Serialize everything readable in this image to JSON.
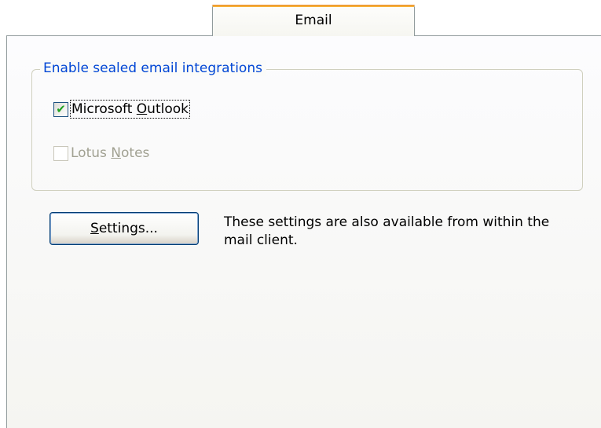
{
  "tab": {
    "label": "Email"
  },
  "group": {
    "legend": "Enable sealed email integrations",
    "items": [
      {
        "name": "microsoft-outlook",
        "label_before": "Microsoft ",
        "mnemonic": "O",
        "label_after": "utlook",
        "checked": true,
        "enabled": true
      },
      {
        "name": "lotus-notes",
        "label_before": "Lotus ",
        "mnemonic": "N",
        "label_after": "otes",
        "checked": false,
        "enabled": false
      }
    ]
  },
  "settings_button": {
    "mnemonic": "S",
    "label_rest": "ettings..."
  },
  "info": {
    "text": "These settings are also available from within the mail client."
  },
  "colors": {
    "tab_accent": "#f7b13c",
    "legend_text": "#0046d5",
    "checkmark": "#21a121",
    "disabled_text": "#a1a192"
  }
}
